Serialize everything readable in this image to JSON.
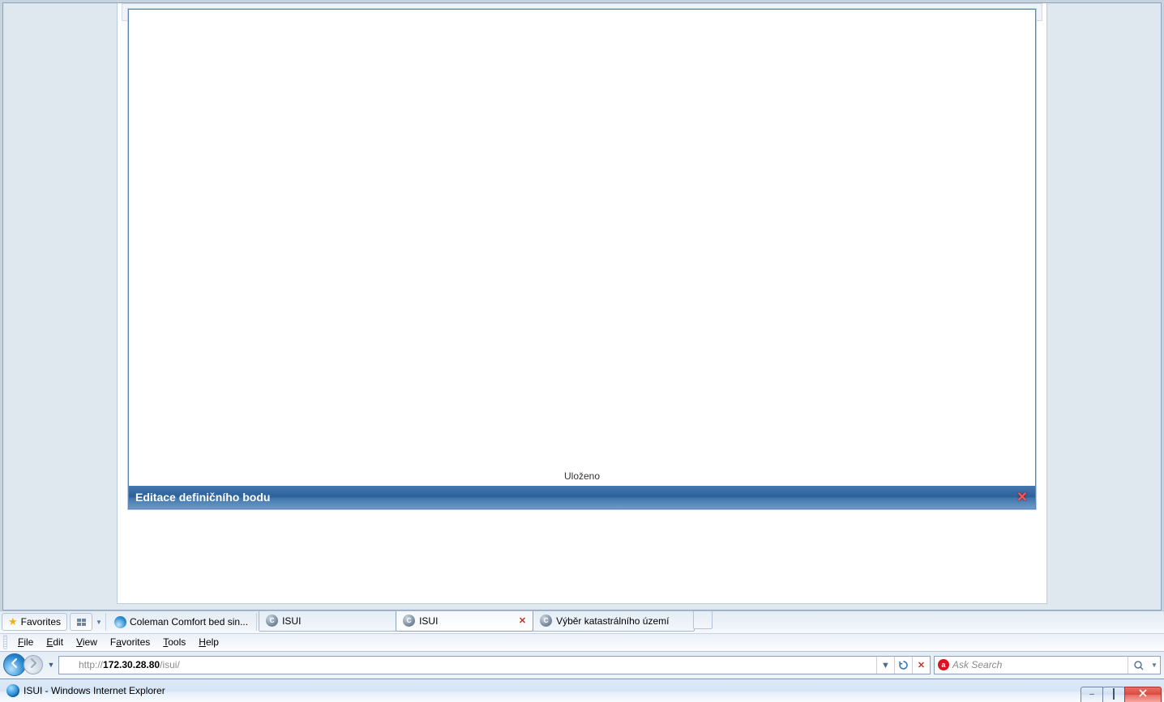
{
  "window": {
    "title": "ISUI - Windows Internet Explorer"
  },
  "winbtns": {
    "minimize": "–",
    "close": "×"
  },
  "address": {
    "scheme": "http://",
    "host": "172.30.28.80",
    "path": "/isui/"
  },
  "search": {
    "placeholder": "Ask Search"
  },
  "menu": {
    "file": "File",
    "edit": "Edit",
    "view": "View",
    "favorites": "Favorites",
    "tools": "Tools",
    "help": "Help",
    "file_u": "F",
    "edit_u": "E",
    "view_u": "V",
    "favorites_u": "a",
    "tools_u": "T",
    "help_u": "H"
  },
  "fav": {
    "label": "Favorites",
    "link1": "Coleman Comfort bed sin..."
  },
  "tabs": {
    "t1": "ISUI",
    "t2": "ISUI",
    "t3": "Výběr katastrálního území"
  },
  "statusbar": "",
  "modal": {
    "title": "Editace definičního bodu",
    "status": "Uloženo"
  }
}
